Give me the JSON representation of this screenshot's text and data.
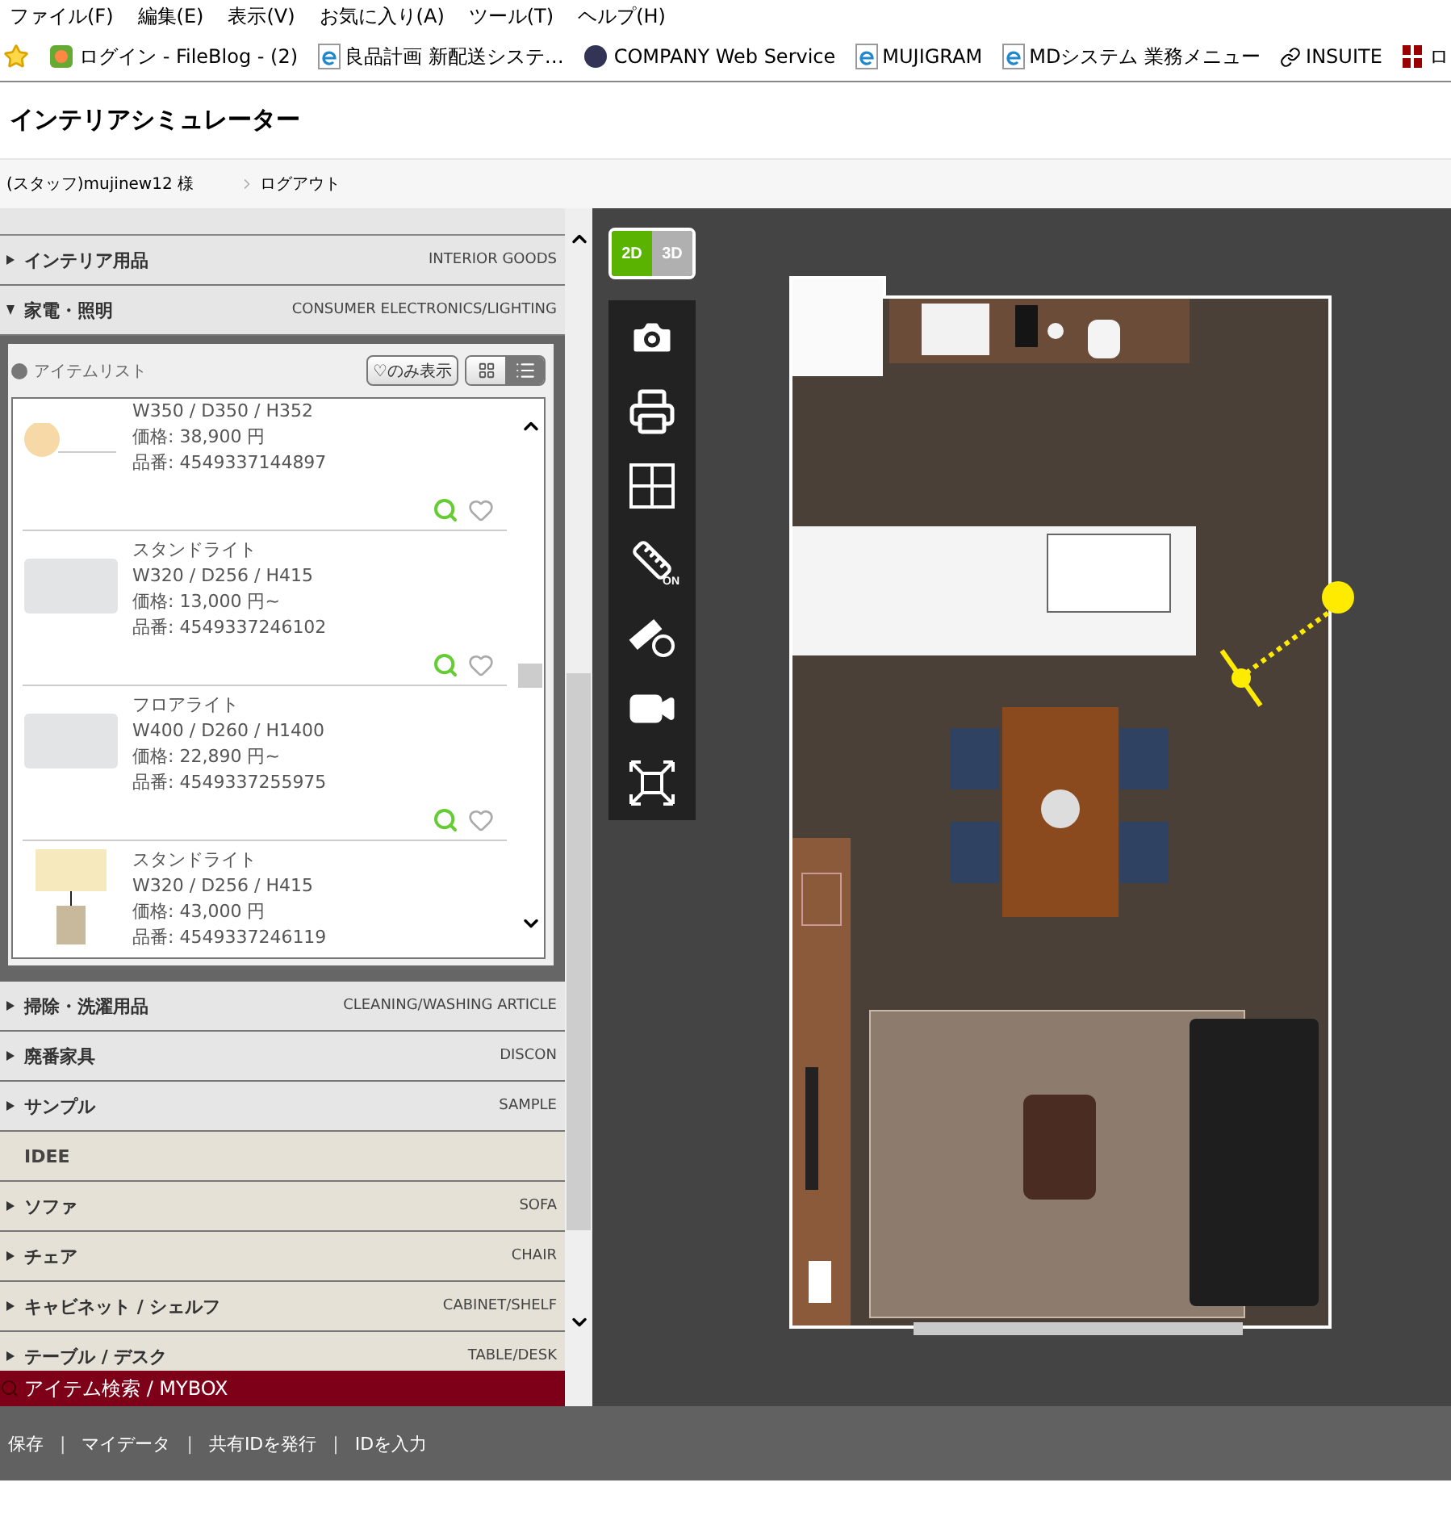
{
  "menu_bar": [
    "ファイル(F)",
    "編集(E)",
    "表示(V)",
    "お気に入り(A)",
    "ツール(T)",
    "ヘルプ(H)"
  ],
  "favorites_bar": [
    {
      "kind": "app",
      "label": "ログイン - FileBlog - (2)"
    },
    {
      "kind": "ie",
      "label": "良品計画 新配送システ…"
    },
    {
      "kind": "globe",
      "label": "COMPANY Web Service"
    },
    {
      "kind": "ie",
      "label": "MUJIGRAM"
    },
    {
      "kind": "ie",
      "label": "MDシステム 業務メニュー"
    },
    {
      "kind": "link",
      "label": "INSUITE"
    },
    {
      "kind": "brand",
      "label": "ロ"
    }
  ],
  "header": {
    "title": "インテリアシミュレーター"
  },
  "user_bar": {
    "user": "(スタッフ)mujinew12 様",
    "logout": "ログアウト"
  },
  "sidebar": {
    "categories_top": [
      {
        "label": "インテリア用品",
        "en": "INTERIOR GOODS",
        "expanded": false
      },
      {
        "label": "家電・照明",
        "en": "CONSUMER ELECTRONICS/LIGHTING",
        "expanded": true
      }
    ],
    "item_list": {
      "title": "アイテムリスト",
      "favorites_button": "♡のみ表示",
      "view_modes": [
        {
          "kind": "grid",
          "selected": false
        },
        {
          "kind": "list",
          "selected": true
        }
      ],
      "items": [
        {
          "kind": "pendant",
          "size": "W350 / D350 / H352",
          "price": "価格: 38,900 円",
          "code": "品番: 4549337144897"
        },
        {
          "kind": "shade",
          "name": "スタンドライト",
          "size": "W320 / D256 / H415",
          "price": "価格: 13,000 円~",
          "code": "品番: 4549337246102"
        },
        {
          "kind": "shade",
          "name": "フロアライト",
          "size": "W400 / D260 / H1400",
          "price": "価格: 22,890 円~",
          "code": "品番: 4549337255975"
        },
        {
          "kind": "lamp",
          "name": "スタンドライト",
          "size": "W320 / D256 / H415",
          "price": "価格: 43,000 円",
          "code": "品番: 4549337246119"
        }
      ]
    },
    "categories_bottom": [
      {
        "label": "掃除・洗濯用品",
        "en": "CLEANING/WASHING ARTICLE",
        "expanded": false
      },
      {
        "label": "廃番家具",
        "en": "DISCON",
        "expanded": false
      },
      {
        "label": "サンプル",
        "en": "SAMPLE",
        "expanded": false
      }
    ],
    "idee": {
      "title": "IDEE",
      "categories": [
        {
          "label": "ソファ",
          "en": "SOFA",
          "expanded": false
        },
        {
          "label": "チェア",
          "en": "CHAIR",
          "expanded": false
        },
        {
          "label": "キャビネット / シェルフ",
          "en": "CABINET/SHELF",
          "expanded": false
        },
        {
          "label": "テーブル / デスク",
          "en": "TABLE/DESK",
          "expanded": false
        }
      ]
    },
    "search_bar": "アイテム検索 / MYBOX"
  },
  "canvas": {
    "modes": [
      {
        "label": "2D",
        "selected": true
      },
      {
        "label": "3D",
        "selected": false
      }
    ],
    "tools": [
      {
        "kind": "camera"
      },
      {
        "kind": "print"
      },
      {
        "kind": "grid"
      },
      {
        "kind": "ruler",
        "badge": "ON"
      },
      {
        "kind": "ruler_swap"
      },
      {
        "kind": "camera_swap"
      },
      {
        "kind": "fit"
      }
    ]
  },
  "footer": {
    "separator": "|",
    "links": [
      "保存",
      "マイデータ",
      "共有IDを発行",
      "IDを入力"
    ]
  }
}
